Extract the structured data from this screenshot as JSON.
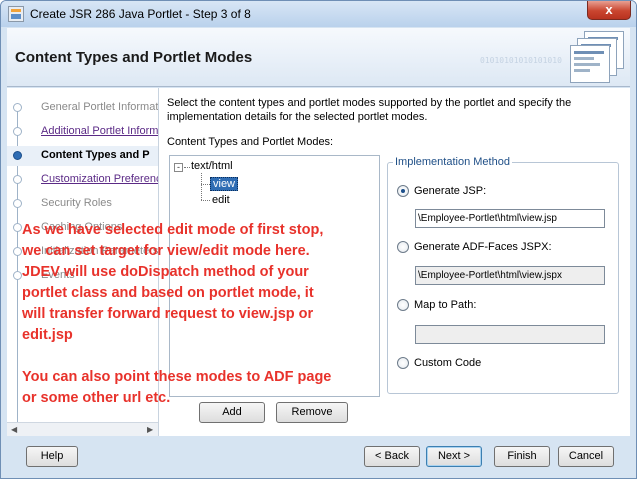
{
  "window": {
    "title": "Create JSR 286 Java Portlet - Step 3 of 8",
    "close_glyph": "x"
  },
  "header": {
    "title": "Content Types and Portlet Modes",
    "graphic_text": "01010101010101010"
  },
  "steps": [
    {
      "label": "General Portlet Informat",
      "state": "done"
    },
    {
      "label": "Additional Portlet Inform",
      "state": "link"
    },
    {
      "label": "Content Types and P",
      "state": "current"
    },
    {
      "label": "Customization Preferenc",
      "state": "link"
    },
    {
      "label": "Security Roles",
      "state": "future"
    },
    {
      "label": "Caching Options",
      "state": "future"
    },
    {
      "label": "Initialization Parameters",
      "state": "future"
    },
    {
      "label": "Events",
      "state": "future"
    }
  ],
  "content": {
    "description": "Select the content types and portlet modes supported by the portlet and specify the implementation details for the selected portlet modes.",
    "tree_caption": "Content Types and Portlet Modes:",
    "tree": {
      "toggle": "-",
      "root": "text/html",
      "children": [
        "view",
        "edit"
      ],
      "selected": "view"
    },
    "add_button": "Add",
    "remove_button": "Remove"
  },
  "implementation": {
    "legend": "Implementation Method",
    "options": [
      {
        "label": "Generate JSP:",
        "checked": true,
        "value": "\\Employee-Portlet\\html\\view.jsp"
      },
      {
        "label": "Generate ADF-Faces JSPX:",
        "checked": false,
        "value": "\\Employee-Portlet\\html\\view.jspx"
      },
      {
        "label": "Map to Path:",
        "checked": false,
        "value": ""
      },
      {
        "label": "Custom Code",
        "checked": false
      }
    ]
  },
  "annotation": {
    "lines": [
      "As we have selected edit mode of first stop,",
      "we can set target for view/edit mode here.",
      "JDEV will use doDispatch method of your",
      "portlet class and based on portlet mode, it",
      "will transfer forward request to view.jsp or",
      "edit.jsp",
      "",
      "You can also point these modes to ADF page",
      "or some other url etc."
    ],
    "color": "#e8322b"
  },
  "footer": {
    "help": "Help",
    "back": "< Back",
    "next": "Next >",
    "finish": "Finish",
    "cancel": "Cancel"
  }
}
